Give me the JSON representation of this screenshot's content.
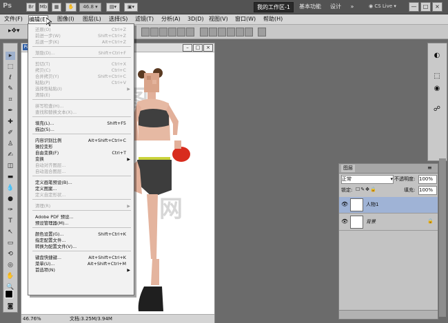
{
  "app": {
    "logo": "Ps",
    "zoom_select": "46.8",
    "workspace_buttons": [
      "我的工作区-1",
      "基本功能",
      "设计"
    ],
    "overflow": "»",
    "cs_live": "CS Live",
    "window_buttons": [
      "—",
      "□",
      "×"
    ]
  },
  "menubar": [
    "文件(F)",
    "编辑(E)",
    "图像(I)",
    "图层(L)",
    "选择(S)",
    "滤镜(T)",
    "分析(A)",
    "3D(D)",
    "视图(V)",
    "窗口(W)",
    "帮助(H)"
  ],
  "edit_menu": {
    "items": [
      {
        "label": "还原(O)",
        "shortcut": "Ctrl+Z",
        "enabled": false
      },
      {
        "label": "前进一步(W)",
        "shortcut": "Shift+Ctrl+Z",
        "enabled": false
      },
      {
        "label": "后退一步(K)",
        "shortcut": "Alt+Ctrl+Z",
        "enabled": false
      },
      {
        "label": "渐隐(D)...",
        "shortcut": "Shift+Ctrl+F",
        "enabled": false
      },
      {
        "label": "剪切(T)",
        "shortcut": "Ctrl+X",
        "enabled": false
      },
      {
        "label": "拷贝(C)",
        "shortcut": "Ctrl+C",
        "enabled": false
      },
      {
        "label": "合并拷贝(Y)",
        "shortcut": "Shift+Ctrl+C",
        "enabled": false
      },
      {
        "label": "粘贴(P)",
        "shortcut": "Ctrl+V",
        "enabled": false
      },
      {
        "label": "选择性粘贴(I)",
        "shortcut": "",
        "enabled": false,
        "submenu": true
      },
      {
        "label": "清除(E)",
        "shortcut": "",
        "enabled": false
      },
      {
        "label": "拼写检查(H)...",
        "shortcut": "",
        "enabled": false
      },
      {
        "label": "查找和替换文本(X)...",
        "shortcut": "",
        "enabled": false
      },
      {
        "label": "填充(L)...",
        "shortcut": "Shift+F5",
        "enabled": true
      },
      {
        "label": "描边(S)...",
        "shortcut": "",
        "enabled": true
      },
      {
        "label": "内容识别比例",
        "shortcut": "Alt+Shift+Ctrl+C",
        "enabled": true
      },
      {
        "label": "操控变形",
        "shortcut": "",
        "enabled": true
      },
      {
        "label": "自由变换(F)",
        "shortcut": "Ctrl+T",
        "enabled": true
      },
      {
        "label": "变换",
        "shortcut": "",
        "enabled": true,
        "submenu": true
      },
      {
        "label": "自动对齐图层...",
        "shortcut": "",
        "enabled": false
      },
      {
        "label": "自动混合图层...",
        "shortcut": "",
        "enabled": false
      },
      {
        "label": "定义画笔预设(B)...",
        "shortcut": "",
        "enabled": true
      },
      {
        "label": "定义图案...",
        "shortcut": "",
        "enabled": true
      },
      {
        "label": "定义自定形状...",
        "shortcut": "",
        "enabled": false
      },
      {
        "label": "清理(R)",
        "shortcut": "",
        "enabled": false,
        "submenu": true
      },
      {
        "label": "Adobe PDF 预设...",
        "shortcut": "",
        "enabled": true
      },
      {
        "label": "预设管理器(M)...",
        "shortcut": "",
        "enabled": true
      },
      {
        "label": "颜色设置(G)...",
        "shortcut": "Shift+Ctrl+K",
        "enabled": true
      },
      {
        "label": "指定配置文件...",
        "shortcut": "",
        "enabled": true
      },
      {
        "label": "转换为配置文件(V)...",
        "shortcut": "",
        "enabled": true
      },
      {
        "label": "键盘快捷键...",
        "shortcut": "Alt+Shift+Ctrl+K",
        "enabled": true
      },
      {
        "label": "菜单(U)...",
        "shortcut": "Alt+Shift+Ctrl+M",
        "enabled": true
      },
      {
        "label": "首选项(N)",
        "shortcut": "",
        "enabled": true,
        "submenu": true
      }
    ]
  },
  "document": {
    "tab_icon": "Ps",
    "zoom": "46.76%",
    "status": "文档:3.25M/3.94M"
  },
  "layers_panel": {
    "tab": "图层",
    "blend_mode": "正常",
    "opacity_label": "不透明度:",
    "opacity": "100%",
    "lock_label": "锁定:",
    "fill_label": "填充:",
    "fill": "100%",
    "layers": [
      {
        "name": "人物1",
        "selected": true
      },
      {
        "name": "背景",
        "selected": false,
        "locked": true
      }
    ]
  },
  "colors": {
    "accent_selected": "#9fb3d6",
    "menu_bg": "#f2f2f2",
    "disabled_text": "#a2a2a2"
  }
}
